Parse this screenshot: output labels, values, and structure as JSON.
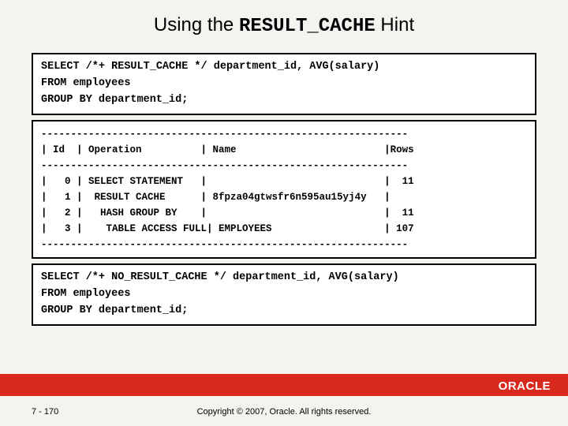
{
  "title": {
    "pre": "Using the ",
    "code": "RESULT_CACHE",
    "post": " Hint"
  },
  "sql1": "SELECT /*+ RESULT_CACHE */ department_id, AVG(salary)\nFROM employees\nGROUP BY department_id;",
  "plan": "--------------------------------------------------------------\n| Id  | Operation          | Name                         |Rows\n--------------------------------------------------------------\n|   0 | SELECT STATEMENT   |                              |  11\n|   1 |  RESULT CACHE      | 8fpza04gtwsfr6n595au15yj4y   |\n|   2 |   HASH GROUP BY    |                              |  11\n|   3 |    TABLE ACCESS FULL| EMPLOYEES                   | 107\n--------------------------------------------------------------",
  "sql2": "SELECT /*+ NO_RESULT_CACHE */ department_id, AVG(salary)\nFROM employees\nGROUP BY department_id;",
  "footer": {
    "logo": "ORACLE",
    "page": "7 - 170",
    "copyright": "Copyright © 2007, Oracle. All rights reserved."
  }
}
